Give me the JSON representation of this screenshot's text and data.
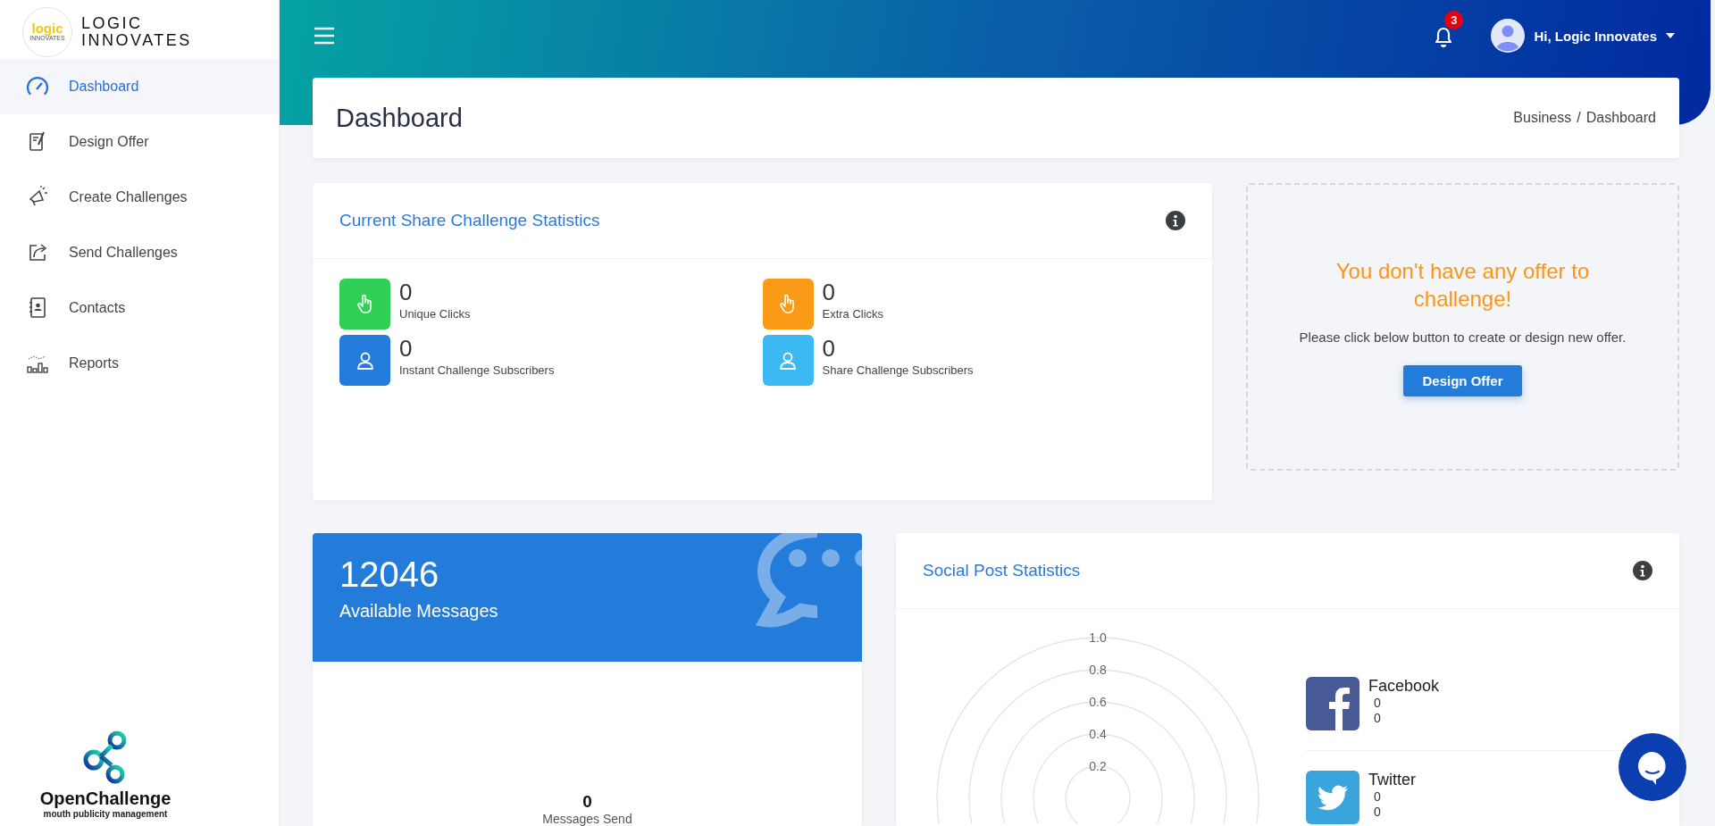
{
  "sidebar": {
    "brand": {
      "logo_text": "logic",
      "logo_subtext": "INNOVATES",
      "name_lines": [
        "LOGIC",
        "INNOVATES"
      ]
    },
    "items": [
      {
        "label": "Dashboard",
        "kind": "gauge",
        "selected": true
      },
      {
        "label": "Design Offer",
        "kind": "design",
        "selected": false
      },
      {
        "label": "Create Challenges",
        "kind": "megaphone",
        "selected": false
      },
      {
        "label": "Send Challenges",
        "kind": "share",
        "selected": false
      },
      {
        "label": "Contacts",
        "kind": "contacts",
        "selected": false
      },
      {
        "label": "Reports",
        "kind": "reports",
        "selected": false
      }
    ],
    "footer": {
      "title": "OpenChallenge",
      "tagline": "mouth publicity management"
    }
  },
  "topbar": {
    "notifications_count": "3",
    "user_greeting": "Hi, Logic Innovates"
  },
  "page_header": {
    "title": "Dashboard",
    "breadcrumb": [
      "Business",
      "Dashboard"
    ],
    "breadcrumb_separator": "/"
  },
  "share_stats": {
    "title": "Current Share Challenge Statistics",
    "stats": [
      {
        "value": "0",
        "label": "Unique Clicks",
        "kind": "clicks",
        "color": "#30cf55"
      },
      {
        "value": "0",
        "label": "Extra Clicks",
        "kind": "clicks",
        "color": "#fa9b17"
      },
      {
        "value": "0",
        "label": "Instant Challenge Subscribers",
        "kind": "subscribers",
        "color": "#247cda"
      },
      {
        "value": "0",
        "label": "Share Challenge Subscribers",
        "kind": "subscribers",
        "color": "#3cb9f3"
      }
    ]
  },
  "empty_offer": {
    "heading": "You don't have any offer to challenge!",
    "message": "Please click below button to create or design new offer.",
    "button": "Design Offer"
  },
  "messages": {
    "available_count": "12046",
    "available_label": "Available Messages",
    "sent_count": "0",
    "sent_label": "Messages Send"
  },
  "social": {
    "title": "Social Post Statistics",
    "radial_ticks": [
      "1.0",
      "0.8",
      "0.6",
      "0.4",
      "0.2"
    ],
    "networks": [
      {
        "name": "Facebook",
        "kind": "facebook",
        "values": [
          "0",
          "0"
        ]
      },
      {
        "name": "Twitter",
        "kind": "twitter",
        "values": [
          "0",
          "0"
        ]
      }
    ]
  }
}
